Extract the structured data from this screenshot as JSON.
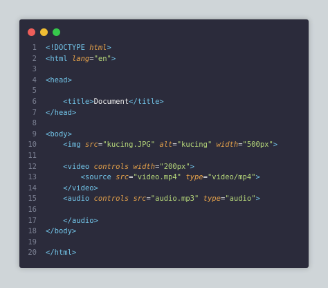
{
  "window_controls": {
    "close_color": "#ee5e5a",
    "minimize_color": "#f0bd33",
    "maximize_color": "#36c84b"
  },
  "colors": {
    "tag": "#72c4e8",
    "attribute": "#e6a24a",
    "string": "#b6d77a",
    "text": "#e8e8e8",
    "line_number": "#7d8294"
  },
  "lines": [
    {
      "n": "1",
      "tokens": [
        {
          "k": "t",
          "v": "<!DOCTYPE "
        },
        {
          "k": "a",
          "v": "html"
        },
        {
          "k": "t",
          "v": ">"
        }
      ]
    },
    {
      "n": "2",
      "tokens": [
        {
          "k": "t",
          "v": "<html "
        },
        {
          "k": "a",
          "v": "lang"
        },
        {
          "k": "p",
          "v": "="
        },
        {
          "k": "s",
          "v": "\"en\""
        },
        {
          "k": "t",
          "v": ">"
        }
      ]
    },
    {
      "n": "3",
      "tokens": []
    },
    {
      "n": "4",
      "tokens": [
        {
          "k": "t",
          "v": "<head>"
        }
      ]
    },
    {
      "n": "5",
      "tokens": []
    },
    {
      "n": "6",
      "tokens": [
        {
          "k": "x",
          "v": "    "
        },
        {
          "k": "t",
          "v": "<title>"
        },
        {
          "k": "x",
          "v": "Document"
        },
        {
          "k": "t",
          "v": "</title>"
        }
      ]
    },
    {
      "n": "7",
      "tokens": [
        {
          "k": "t",
          "v": "</head>"
        }
      ]
    },
    {
      "n": "8",
      "tokens": []
    },
    {
      "n": "9",
      "tokens": [
        {
          "k": "t",
          "v": "<body>"
        }
      ]
    },
    {
      "n": "10",
      "tokens": [
        {
          "k": "x",
          "v": "    "
        },
        {
          "k": "t",
          "v": "<img "
        },
        {
          "k": "a",
          "v": "src"
        },
        {
          "k": "p",
          "v": "="
        },
        {
          "k": "s",
          "v": "\"kucing.JPG\""
        },
        {
          "k": "x",
          "v": " "
        },
        {
          "k": "a",
          "v": "alt"
        },
        {
          "k": "p",
          "v": "="
        },
        {
          "k": "s",
          "v": "\"kucing\""
        },
        {
          "k": "x",
          "v": " "
        },
        {
          "k": "a",
          "v": "width"
        },
        {
          "k": "p",
          "v": "="
        },
        {
          "k": "s",
          "v": "\"500px\""
        },
        {
          "k": "t",
          "v": ">"
        }
      ]
    },
    {
      "n": "11",
      "tokens": []
    },
    {
      "n": "12",
      "tokens": [
        {
          "k": "x",
          "v": "    "
        },
        {
          "k": "t",
          "v": "<video "
        },
        {
          "k": "a",
          "v": "controls"
        },
        {
          "k": "x",
          "v": " "
        },
        {
          "k": "a",
          "v": "width"
        },
        {
          "k": "p",
          "v": "="
        },
        {
          "k": "s",
          "v": "\"200px\""
        },
        {
          "k": "t",
          "v": ">"
        }
      ]
    },
    {
      "n": "13",
      "tokens": [
        {
          "k": "x",
          "v": "        "
        },
        {
          "k": "t",
          "v": "<source "
        },
        {
          "k": "a",
          "v": "src"
        },
        {
          "k": "p",
          "v": "="
        },
        {
          "k": "s",
          "v": "\"video.mp4\""
        },
        {
          "k": "x",
          "v": " "
        },
        {
          "k": "a",
          "v": "type"
        },
        {
          "k": "p",
          "v": "="
        },
        {
          "k": "s",
          "v": "\"video/mp4\""
        },
        {
          "k": "t",
          "v": ">"
        }
      ]
    },
    {
      "n": "14",
      "tokens": [
        {
          "k": "x",
          "v": "    "
        },
        {
          "k": "t",
          "v": "</video>"
        }
      ]
    },
    {
      "n": "15",
      "tokens": [
        {
          "k": "x",
          "v": "    "
        },
        {
          "k": "t",
          "v": "<audio "
        },
        {
          "k": "a",
          "v": "controls"
        },
        {
          "k": "x",
          "v": " "
        },
        {
          "k": "a",
          "v": "src"
        },
        {
          "k": "p",
          "v": "="
        },
        {
          "k": "s",
          "v": "\"audio.mp3\""
        },
        {
          "k": "x",
          "v": " "
        },
        {
          "k": "a",
          "v": "type"
        },
        {
          "k": "p",
          "v": "="
        },
        {
          "k": "s",
          "v": "\"audio\""
        },
        {
          "k": "t",
          "v": ">"
        }
      ]
    },
    {
      "n": "16",
      "tokens": []
    },
    {
      "n": "17",
      "tokens": [
        {
          "k": "x",
          "v": "    "
        },
        {
          "k": "t",
          "v": "</audio>"
        }
      ]
    },
    {
      "n": "18",
      "tokens": [
        {
          "k": "t",
          "v": "</body>"
        }
      ]
    },
    {
      "n": "19",
      "tokens": []
    },
    {
      "n": "20",
      "tokens": [
        {
          "k": "t",
          "v": "</html>"
        }
      ]
    }
  ]
}
